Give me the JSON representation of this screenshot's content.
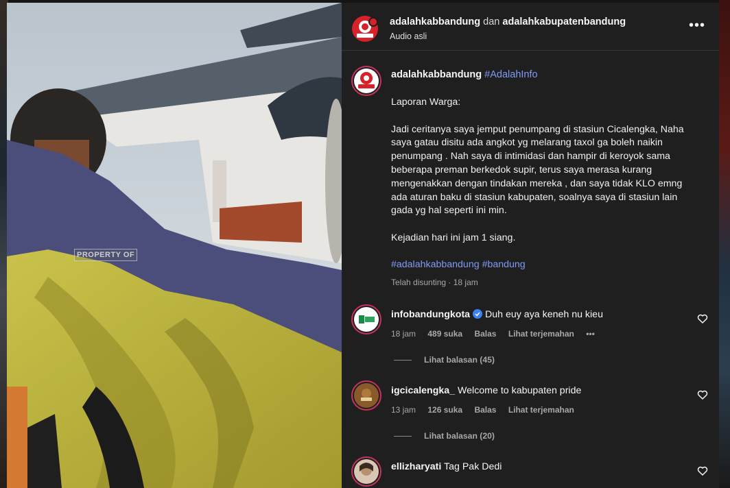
{
  "media": {
    "watermark": "PROPERTY OF"
  },
  "header": {
    "user1": "adalahkabbandung",
    "conjunction": "dan",
    "user2": "adalahkabupatenbandung",
    "audio": "Audio asli",
    "more_icon": "more-horizontal-icon"
  },
  "caption": {
    "username": "adalahkabbandung",
    "hashtag": "#AdalahInfo",
    "body": "Laporan Warga:\n\nJadi ceritanya saya jemput penumpang di stasiun Cicalengka, Naha saya gatau disitu ada angkot yg melarang taxol ga boleh naikin penumpang . Nah saya di intimidasi dan hampir di keroyok sama beberapa preman berkedok supir, terus saya merasa kurang mengenakkan dengan tindakan mereka , dan saya tidak KLO emng ada aturan baku di stasiun kabupaten, soalnya saya di stasiun lain gada yg hal seperti ini min.\n\nKejadian hari ini jam 1 siang.",
    "tag1": "#adalahkabbandung",
    "tag2": "#bandung",
    "meta": "Telah disunting · 18 jam"
  },
  "comments": [
    {
      "username": "infobandungkota",
      "verified": true,
      "text": "Duh euy aya keneh nu kieu",
      "time": "18 jam",
      "likes": "489 suka",
      "reply": "Balas",
      "translate": "Lihat terjemahan",
      "options": "•••",
      "replies": "Lihat balasan (45)"
    },
    {
      "username": "igcicalengka_",
      "verified": false,
      "text": "Welcome to kabupaten pride",
      "time": "13 jam",
      "likes": "126 suka",
      "reply": "Balas",
      "translate": "Lihat terjemahan",
      "replies": "Lihat balasan (20)"
    },
    {
      "username": "ellizharyati",
      "verified": false,
      "text": "Tag Pak Dedi"
    }
  ],
  "colors": {
    "panel": "#1f1f1f",
    "link": "#7f9cf5",
    "verified": "#3b82f6",
    "muted": "#a8a8a8"
  }
}
